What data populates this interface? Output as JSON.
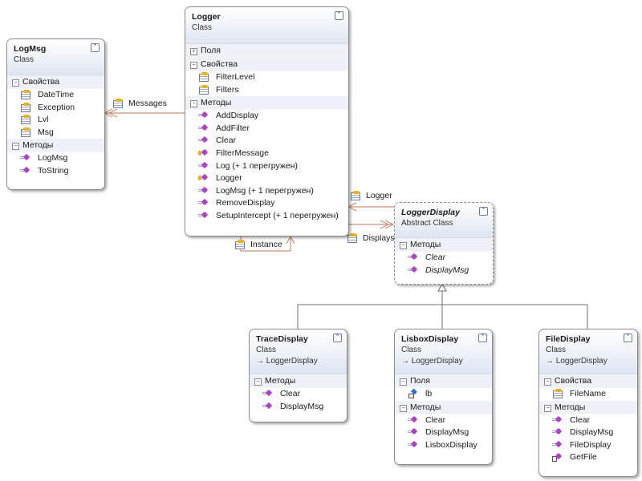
{
  "classes": [
    {
      "id": "logmsg",
      "name": "LogMsg",
      "stereotype": "Class",
      "abstract": false,
      "sections": [
        {
          "title": "Свойства",
          "expanded": true,
          "items": [
            {
              "name": "DateTime",
              "icon": "property"
            },
            {
              "name": "Exception",
              "icon": "property"
            },
            {
              "name": "Lvl",
              "icon": "property"
            },
            {
              "name": "Msg",
              "icon": "property"
            }
          ]
        },
        {
          "title": "Методы",
          "expanded": true,
          "items": [
            {
              "name": "LogMsg",
              "icon": "method"
            },
            {
              "name": "ToString",
              "icon": "method"
            }
          ]
        }
      ]
    },
    {
      "id": "logger",
      "name": "Logger",
      "stereotype": "Class",
      "abstract": false,
      "sections": [
        {
          "title": "Поля",
          "expanded": false,
          "items": []
        },
        {
          "title": "Свойства",
          "expanded": true,
          "items": [
            {
              "name": "FilterLevel",
              "icon": "property"
            },
            {
              "name": "Filters",
              "icon": "property"
            }
          ]
        },
        {
          "title": "Методы",
          "expanded": true,
          "items": [
            {
              "name": "AddDisplay",
              "icon": "method"
            },
            {
              "name": "AddFilter",
              "icon": "method"
            },
            {
              "name": "Clear",
              "icon": "method"
            },
            {
              "name": "FilterMessage",
              "icon": "protected"
            },
            {
              "name": "Log (+ 1 перегружен)",
              "icon": "method"
            },
            {
              "name": "Logger",
              "icon": "protected"
            },
            {
              "name": "LogMsg (+ 1 перегружен)",
              "icon": "method"
            },
            {
              "name": "RemoveDisplay",
              "icon": "method"
            },
            {
              "name": "SetupIntercept (+ 1 перегружен)",
              "icon": "method"
            }
          ]
        }
      ]
    },
    {
      "id": "loggerdisplay",
      "name": "LoggerDisplay",
      "stereotype": "Abstract Class",
      "abstract": true,
      "sections": [
        {
          "title": "Методы",
          "expanded": true,
          "items": [
            {
              "name": "Clear",
              "icon": "method",
              "italic": true
            },
            {
              "name": "DisplayMsg",
              "icon": "method",
              "italic": true
            }
          ]
        }
      ]
    },
    {
      "id": "tracedisplay",
      "name": "TraceDisplay",
      "stereotype": "Class",
      "base": "LoggerDisplay",
      "abstract": false,
      "sections": [
        {
          "title": "Методы",
          "expanded": true,
          "items": [
            {
              "name": "Clear",
              "icon": "method"
            },
            {
              "name": "DisplayMsg",
              "icon": "method"
            }
          ]
        }
      ]
    },
    {
      "id": "lisboxdisplay",
      "name": "LisboxDisplay",
      "stereotype": "Class",
      "base": "LoggerDisplay",
      "abstract": false,
      "sections": [
        {
          "title": "Поля",
          "expanded": true,
          "items": [
            {
              "name": "lb",
              "icon": "field"
            }
          ]
        },
        {
          "title": "Методы",
          "expanded": true,
          "items": [
            {
              "name": "Clear",
              "icon": "method"
            },
            {
              "name": "DisplayMsg",
              "icon": "method"
            },
            {
              "name": "LisboxDisplay",
              "icon": "method"
            }
          ]
        }
      ]
    },
    {
      "id": "filedisplay",
      "name": "FileDisplay",
      "stereotype": "Class",
      "base": "LoggerDisplay",
      "abstract": false,
      "sections": [
        {
          "title": "Свойства",
          "expanded": true,
          "items": [
            {
              "name": "FileName",
              "icon": "property"
            }
          ]
        },
        {
          "title": "Методы",
          "expanded": true,
          "items": [
            {
              "name": "Clear",
              "icon": "method"
            },
            {
              "name": "DisplayMsg",
              "icon": "method"
            },
            {
              "name": "FileDisplay",
              "icon": "method"
            },
            {
              "name": "GetFile",
              "icon": "internal"
            }
          ]
        }
      ]
    }
  ],
  "associations": [
    {
      "id": "messages",
      "label": "Messages",
      "from": "Logger",
      "to": "LogMsg",
      "kind": "collection"
    },
    {
      "id": "logger",
      "label": "Logger",
      "from": "LoggerDisplay",
      "to": "Logger",
      "kind": "single"
    },
    {
      "id": "displays",
      "label": "Displays",
      "from": "Logger",
      "to": "LoggerDisplay",
      "kind": "collection"
    },
    {
      "id": "instance",
      "label": "Instance",
      "from": "Logger",
      "to": "Logger",
      "kind": "single"
    }
  ],
  "inheritance": {
    "base": "LoggerDisplay",
    "derived": [
      "TraceDisplay",
      "LisboxDisplay",
      "FileDisplay"
    ]
  },
  "colors": {
    "association": "#c8907a",
    "inheritance": "#707070",
    "header": "#dfe6f2",
    "section": "#eef1f7"
  }
}
